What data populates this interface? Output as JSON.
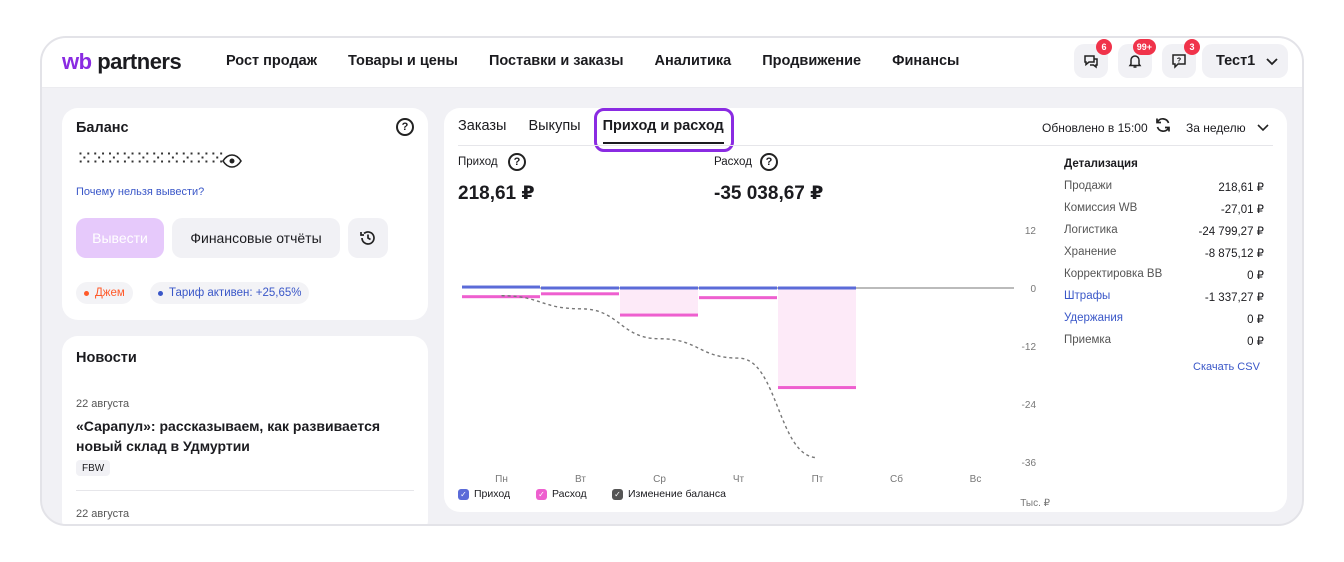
{
  "header": {
    "logo_wb": "wb",
    "logo_rest": "partners",
    "nav": [
      "Рост продаж",
      "Товары и цены",
      "Поставки и заказы",
      "Аналитика",
      "Продвижение",
      "Финансы"
    ],
    "icons": [
      {
        "name": "chat-icon",
        "badge": "6"
      },
      {
        "name": "bell-icon",
        "badge": "99+"
      },
      {
        "name": "support-icon",
        "badge": "3"
      }
    ],
    "user": "Тест1"
  },
  "balance": {
    "title": "Баланс",
    "hidden_value": "⁙⁙⁙⁙⁙⁙⁙⁙⁙⁙",
    "why_link": "Почему нельзя вывести?",
    "withdraw_label": "Вывести",
    "reports_label": "Финансовые отчёты",
    "chips": [
      {
        "label": "Джем",
        "color": "#ff5a2a"
      },
      {
        "label": "Тариф активен: +25,65%",
        "color": "#3a57c8"
      }
    ]
  },
  "news": {
    "title": "Новости",
    "items": [
      {
        "date": "22 августа",
        "headline_line1": "«Сарапул»: рассказываем, как развивается",
        "headline_line2": "новый склад в Удмуртии",
        "tag": "FBW"
      },
      {
        "date": "22 августа"
      }
    ]
  },
  "main": {
    "tabs": [
      "Заказы",
      "Выкупы",
      "Приход и расход"
    ],
    "active_tab": 2,
    "updated": "Обновлено в 15:00",
    "period": "За неделю",
    "income_label": "Приход",
    "income_value": "218,61 ₽",
    "expense_label": "Расход",
    "expense_value": "-35 038,67 ₽",
    "detail_title": "Детализация",
    "details": [
      {
        "label": "Продажи",
        "value": "218,61 ₽",
        "link": false
      },
      {
        "label": "Комиссия WB",
        "value": "-27,01 ₽",
        "link": false
      },
      {
        "label": "Логистика",
        "value": "-24 799,27 ₽",
        "link": false
      },
      {
        "label": "Хранение",
        "value": "-8 875,12 ₽",
        "link": false
      },
      {
        "label": "Корректировка ВВ",
        "value": "0 ₽",
        "link": false
      },
      {
        "label": "Штрафы",
        "value": "-1 337,27 ₽",
        "link": true
      },
      {
        "label": "Удержания",
        "value": "0 ₽",
        "link": true
      },
      {
        "label": "Приемка",
        "value": "0 ₽",
        "link": false
      }
    ],
    "csv_link": "Скачать CSV"
  },
  "chart_data": {
    "type": "bar",
    "categories": [
      "Пн",
      "Вт",
      "Ср",
      "Чт",
      "Пт",
      "Сб",
      "Вс"
    ],
    "ylim": [
      -36,
      12
    ],
    "yticks": [
      "12",
      "0",
      "-12",
      "-24",
      "-36"
    ],
    "yunit": "Тыс. ₽",
    "series": [
      {
        "name": "Приход",
        "color": "#5b6bd8",
        "values": [
          0.2,
          0.0,
          0.0,
          0.0,
          0.0,
          0,
          0
        ]
      },
      {
        "name": "Расход",
        "color": "#ee5fcf",
        "values": [
          -1.8,
          -1.2,
          -5.6,
          -2.0,
          -20.6,
          0,
          0
        ]
      },
      {
        "name": "Изменение баланса",
        "color": "#777777",
        "values": [
          -1.6,
          -4.3,
          -10.5,
          -14.5,
          -35.1,
          null,
          null
        ]
      }
    ]
  }
}
